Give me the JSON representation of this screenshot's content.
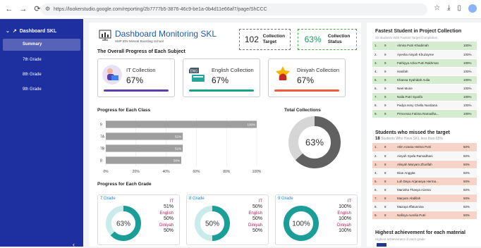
{
  "browser": {
    "url": "https://lookerstudio.google.com/reporting/2b7777b5-3876-46c9-be1a-0b4d11e66af7/page/ShCCC",
    "nav": [
      "←",
      "→",
      "⟳"
    ]
  },
  "sidebar": {
    "title": "Dashboard SKL",
    "items": [
      {
        "label": "Summary",
        "active": true
      },
      {
        "label": "7th Grade",
        "active": false
      },
      {
        "label": "8th Grade",
        "active": false
      },
      {
        "label": "9th Grade",
        "active": false
      }
    ],
    "collapse": "‹"
  },
  "header": {
    "title": "Dashboard Monitoring SKL",
    "subtitle": "SMP IDN Mimeal Boarding School",
    "kpi_target_value": "102",
    "kpi_target_label_1": "Collection",
    "kpi_target_label_2": "Target",
    "kpi_status_value": "63%",
    "kpi_status_label_1": "Collection",
    "kpi_status_label_2": "Status"
  },
  "overall": {
    "title": "The Overall Progress of Each Subject",
    "cards": [
      {
        "title": "IT Collection",
        "pct": "67%",
        "bar_color": "#5b3ea8",
        "icon": "person-laptop-icon"
      },
      {
        "title": "English Collection",
        "pct": "67%",
        "bar_color": "#1aa089",
        "icon": "eng-book-icon"
      },
      {
        "title": "Diniyah Collection",
        "pct": "67%",
        "bar_color": "#ef5a3c",
        "icon": "mosque-icon"
      }
    ]
  },
  "class_chart_title": "Progress for Each Class",
  "total_title": "Total Collections",
  "grade_title": "Progress for Each Grade",
  "chart_data": [
    {
      "type": "bar",
      "orientation": "horizontal",
      "title": "Progress for Each Class",
      "categories": [
        "9",
        "7A",
        "7B",
        "8"
      ],
      "values": [
        100,
        51,
        51,
        50
      ],
      "data_labels": [
        "100%",
        "51%",
        "51%",
        "50%"
      ],
      "xticks": [
        "0%",
        "20%",
        "40%",
        "60%",
        "80%",
        "100%"
      ],
      "xlim": [
        0,
        100
      ],
      "color": "#9e9e9e"
    },
    {
      "type": "pie",
      "title": "Total Collections",
      "center_label": "63%",
      "values": [
        63,
        37
      ],
      "colors": [
        "#616161",
        "#d6d6d6"
      ]
    }
  ],
  "grades": [
    {
      "name": "7 Grade",
      "center": "63%",
      "value": 63,
      "it": "51%",
      "english": "50%",
      "diniyah": "50%"
    },
    {
      "name": "8 Grade",
      "center": "50%",
      "value": 50,
      "it": "50%",
      "english": "50%",
      "diniyah": "50%"
    },
    {
      "name": "9 Grade",
      "center": "100%",
      "value": 100,
      "it": "100%",
      "english": "100%",
      "diniyah": "100%"
    }
  ],
  "grade_labels": {
    "it": "IT",
    "english": "English",
    "diniyah": "Diniyah"
  },
  "fastest": {
    "title": "Fastest Student in Project Collection",
    "subtitle": "20 Students With Fastest Target Completion",
    "rows": [
      [
        "1.",
        "9",
        "Almira Putri Khadimah",
        "100%"
      ],
      [
        "2.",
        "9",
        "Ayesha Aisyah Khuzayme",
        "100%"
      ],
      [
        "3.",
        "9",
        "Fathiyya Azka Putri Rakhman",
        "100%"
      ],
      [
        "4.",
        "9",
        "Hanifah",
        "100%"
      ],
      [
        "5.",
        "9",
        "Khansa Syahidah Aulia",
        "100%"
      ],
      [
        "6.",
        "9",
        "Neel Mune",
        "100%"
      ],
      [
        "7.",
        "9",
        "Naila Putri Syarifa",
        "100%"
      ],
      [
        "8.",
        "9",
        "Padya Ismy Chella Nurdiana",
        "100%"
      ],
      [
        "9.",
        "9",
        "Princessa Fatima Ramadha...",
        "100%"
      ]
    ]
  },
  "missed": {
    "title": "Students who missed the target",
    "count": "18",
    "count_label": "Students Who Have SKL less than 65%",
    "rows": [
      [
        "1.",
        "8",
        "Atiin Azania Helma Putri",
        "50%"
      ],
      [
        "2.",
        "8",
        "Aisyah Syafa Ramadhani",
        "50%"
      ],
      [
        "3.",
        "8",
        "Alisyah Maryam Zhurifah",
        "50%"
      ],
      [
        "4.",
        "8",
        "Dian Anggita",
        "50%"
      ],
      [
        "5.",
        "8",
        "Luh Dayu Arjanasya Herma...",
        "50%"
      ],
      [
        "6.",
        "8",
        "Manisha Thasya Aizena",
        "50%"
      ],
      [
        "7.",
        "8",
        "Maryam Abdillah",
        "50%"
      ],
      [
        "8.",
        "8",
        "Mazaya Iffatunnisa",
        "50%"
      ],
      [
        "9.",
        "8",
        "Nafisya Aurelia Putri",
        "50%"
      ]
    ]
  },
  "highest": {
    "title": "Highest achievement for each material",
    "subtitle": "Highest achievement of each grade"
  }
}
